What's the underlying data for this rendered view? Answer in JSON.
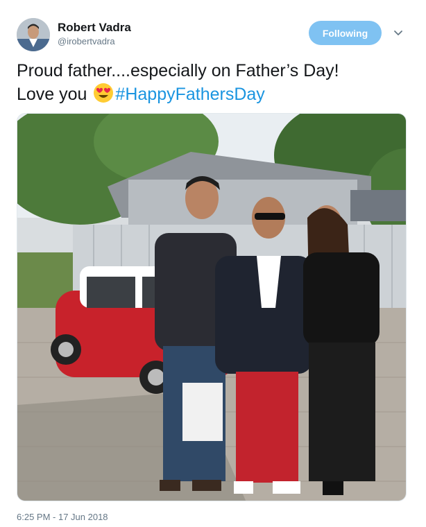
{
  "author": {
    "display_name": "Robert Vadra",
    "handle": "@irobertvadra",
    "avatar_icon": "avatar-icon"
  },
  "follow_button": {
    "label": "Following",
    "color": "#7fc2f2"
  },
  "menu_icon": "chevron-down-icon",
  "tweet": {
    "line1": "Proud father....especially on Father’s Day!",
    "line2_text": "Love you",
    "emoji_icon": "heart-eyes-emoji",
    "hashtag": "#HappyFathersDay",
    "hashtag_color": "#1b95e0"
  },
  "media": {
    "type": "photo",
    "icon": "photo-image"
  },
  "timestamp": "6:25 PM - 17 Jun 2018"
}
